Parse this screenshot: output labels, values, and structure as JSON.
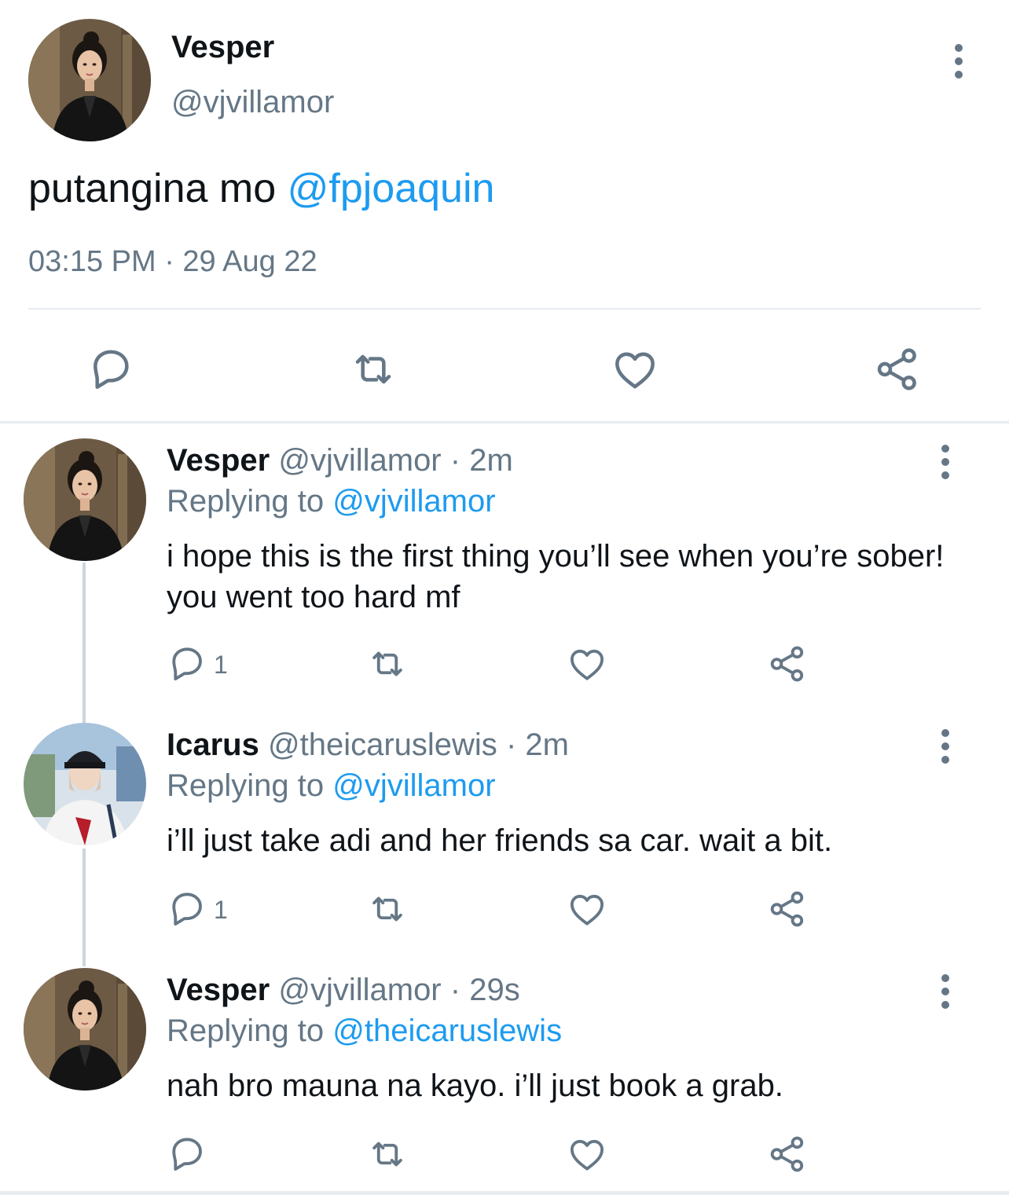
{
  "main_tweet": {
    "display_name": "Vesper",
    "handle": "@vjvillamor",
    "text": "putangina mo",
    "mention": "@fpjoaquin",
    "timestamp": "03:15 PM · 29 Aug 22"
  },
  "replies": [
    {
      "display_name": "Vesper",
      "handle": "@vjvillamor",
      "time": "· 2m",
      "replying_label": "Replying to",
      "replying_to": "@vjvillamor",
      "text": "i hope this is the first thing you’ll see when you’re sober! you went too hard mf",
      "reply_count": "1"
    },
    {
      "display_name": "Icarus",
      "handle": "@theicaruslewis",
      "time": "· 2m",
      "replying_label": "Replying to",
      "replying_to": "@vjvillamor",
      "text": "i’ll just take adi and her friends sa car. wait a bit.",
      "reply_count": "1"
    },
    {
      "display_name": "Vesper",
      "handle": "@vjvillamor",
      "time": "· 29s",
      "replying_label": "Replying to",
      "replying_to": "@theicaruslewis",
      "text": "nah bro mauna na kayo. i’ll just book a grab.",
      "reply_count": ""
    }
  ],
  "icons": [
    "reply-icon",
    "retweet-icon",
    "like-icon",
    "share-icon",
    "more-icon"
  ],
  "colors": {
    "link": "#1d9bf0",
    "secondary_text": "#657786",
    "divider": "#e6ecf0",
    "thread_line": "#ced5dc"
  }
}
